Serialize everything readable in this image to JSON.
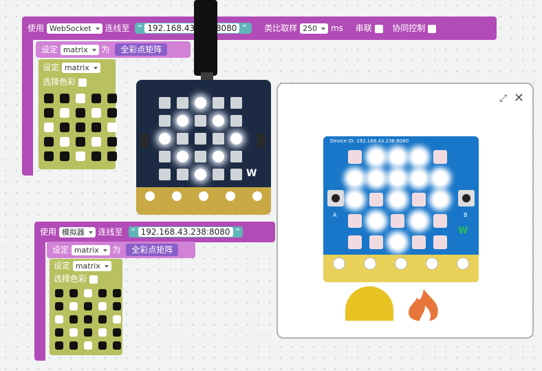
{
  "top_block": {
    "use_label": "使用",
    "mode_value": "WebSocket",
    "connect_label": "连线至",
    "address_quote_open": "“",
    "address": "192.168.43.238:8080",
    "address_quote_close": "”",
    "sampling_label": "类比取样",
    "sampling_value": "250",
    "ms_label": "ms",
    "serial_label": "串联",
    "sync_label": "协同控制"
  },
  "top_set_block": {
    "set_label": "设定",
    "var_value": "matrix",
    "as_label": "为",
    "fullcolor_label": "全彩点矩阵"
  },
  "top_inner_block": {
    "set_label": "设定",
    "var_value": "matrix",
    "pick_color_label": "选择色彩"
  },
  "top_matrix": [
    [
      0,
      0,
      1,
      0,
      0
    ],
    [
      0,
      1,
      0,
      1,
      0
    ],
    [
      1,
      0,
      0,
      0,
      1
    ],
    [
      0,
      1,
      0,
      1,
      0
    ],
    [
      0,
      0,
      1,
      0,
      0
    ]
  ],
  "bottom_block": {
    "use_label": "使用",
    "mode_value": "模拟器",
    "connect_label": "连线至",
    "address_quote_open": "“",
    "address": "192.168.43.238:8080",
    "address_quote_close": "”"
  },
  "bottom_set_block": {
    "set_label": "设定",
    "var_value": "matrix",
    "as_label": "为",
    "fullcolor_label": "全彩点矩阵"
  },
  "bottom_inner_block": {
    "set_label": "设定",
    "var_value": "matrix",
    "pick_color_label": "选择色彩"
  },
  "bottom_matrix": [
    [
      0,
      0,
      1,
      0,
      0
    ],
    [
      0,
      1,
      0,
      1,
      0
    ],
    [
      1,
      0,
      0,
      0,
      1
    ],
    [
      0,
      1,
      0,
      1,
      0
    ],
    [
      0,
      0,
      1,
      0,
      0
    ]
  ],
  "simulator": {
    "device_label": "Device ID: 192.168.43.238:8080",
    "button_a": "A",
    "button_b": "B",
    "matrix": [
      [
        0,
        1,
        1,
        1,
        0
      ],
      [
        1,
        1,
        1,
        1,
        1
      ],
      [
        1,
        0,
        1,
        0,
        1
      ],
      [
        0,
        1,
        0,
        1,
        0
      ],
      [
        0,
        0,
        1,
        0,
        0
      ]
    ]
  },
  "physical_board": {
    "matrix": [
      [
        0,
        0,
        1,
        0,
        0
      ],
      [
        0,
        1,
        0,
        1,
        0
      ],
      [
        1,
        0,
        0,
        0,
        1
      ],
      [
        0,
        1,
        0,
        1,
        0
      ],
      [
        0,
        0,
        1,
        0,
        0
      ]
    ]
  },
  "colors": {
    "block_purple": "#b24bb7",
    "block_olive": "#b8c060",
    "string_teal": "#5fb5b9",
    "sim_board_blue": "#1977c9"
  }
}
